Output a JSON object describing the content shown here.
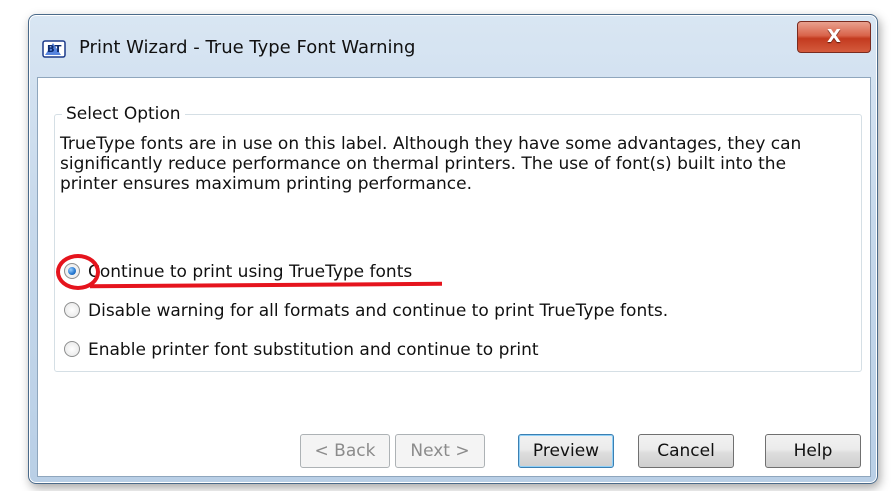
{
  "window": {
    "title": "Print Wizard - True Type Font Warning",
    "close_label": "X"
  },
  "group": {
    "legend": "Select Option",
    "description": "TrueType fonts are in use on this label. Although they have some advantages, they can significantly reduce performance on thermal printers. The use of font(s) built into the printer ensures maximum printing performance."
  },
  "options": [
    {
      "label": "Continue to print using TrueType fonts",
      "selected": true
    },
    {
      "label": "Disable warning for all formats and continue to print TrueType fonts.",
      "selected": false
    },
    {
      "label": "Enable printer font substitution and continue to print",
      "selected": false
    }
  ],
  "buttons": {
    "back": "< Back",
    "next": "Next >",
    "preview": "Preview",
    "cancel": "Cancel",
    "help": "Help"
  },
  "annotation": {
    "color": "#e5141d"
  },
  "icons": {
    "app": "bartender-app-icon",
    "close": "close-icon"
  }
}
